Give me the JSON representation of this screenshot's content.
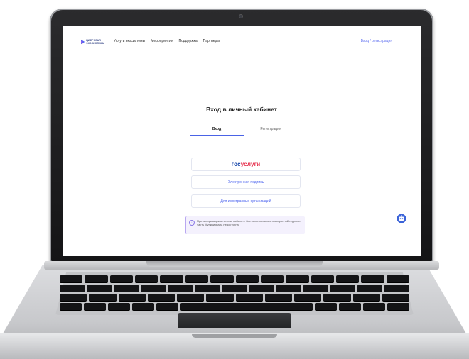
{
  "nav": {
    "logo_text": [
      "ЦИФРОВАЯ",
      "ЭКОСИСТЕМА"
    ],
    "links": [
      "Услуги экосистемы",
      "Мероприятия",
      "Поддержка",
      "Партнеры"
    ],
    "login": "Вход / регистрация"
  },
  "login": {
    "title": "Вход в личный кабинет",
    "tabs": [
      "Вход",
      "Регистрация"
    ],
    "active_tab": "Вход",
    "gosuslugi_part1": "гос",
    "gosuslugi_part2": "услуги",
    "esign": "Электронная подпись",
    "foreign": "Для иностранных организаций",
    "notice": "При авторизации в личном кабинете без использования электронной подписи часть функционала недоступна."
  },
  "colors": {
    "accent": "#4b63ef",
    "gos_blue": "#0d3fa6",
    "gos_red": "#e6304d",
    "notice_bg": "#f4f1fd"
  },
  "icons": [
    "logo-mark-icon",
    "info-icon",
    "chat-bot-icon"
  ]
}
